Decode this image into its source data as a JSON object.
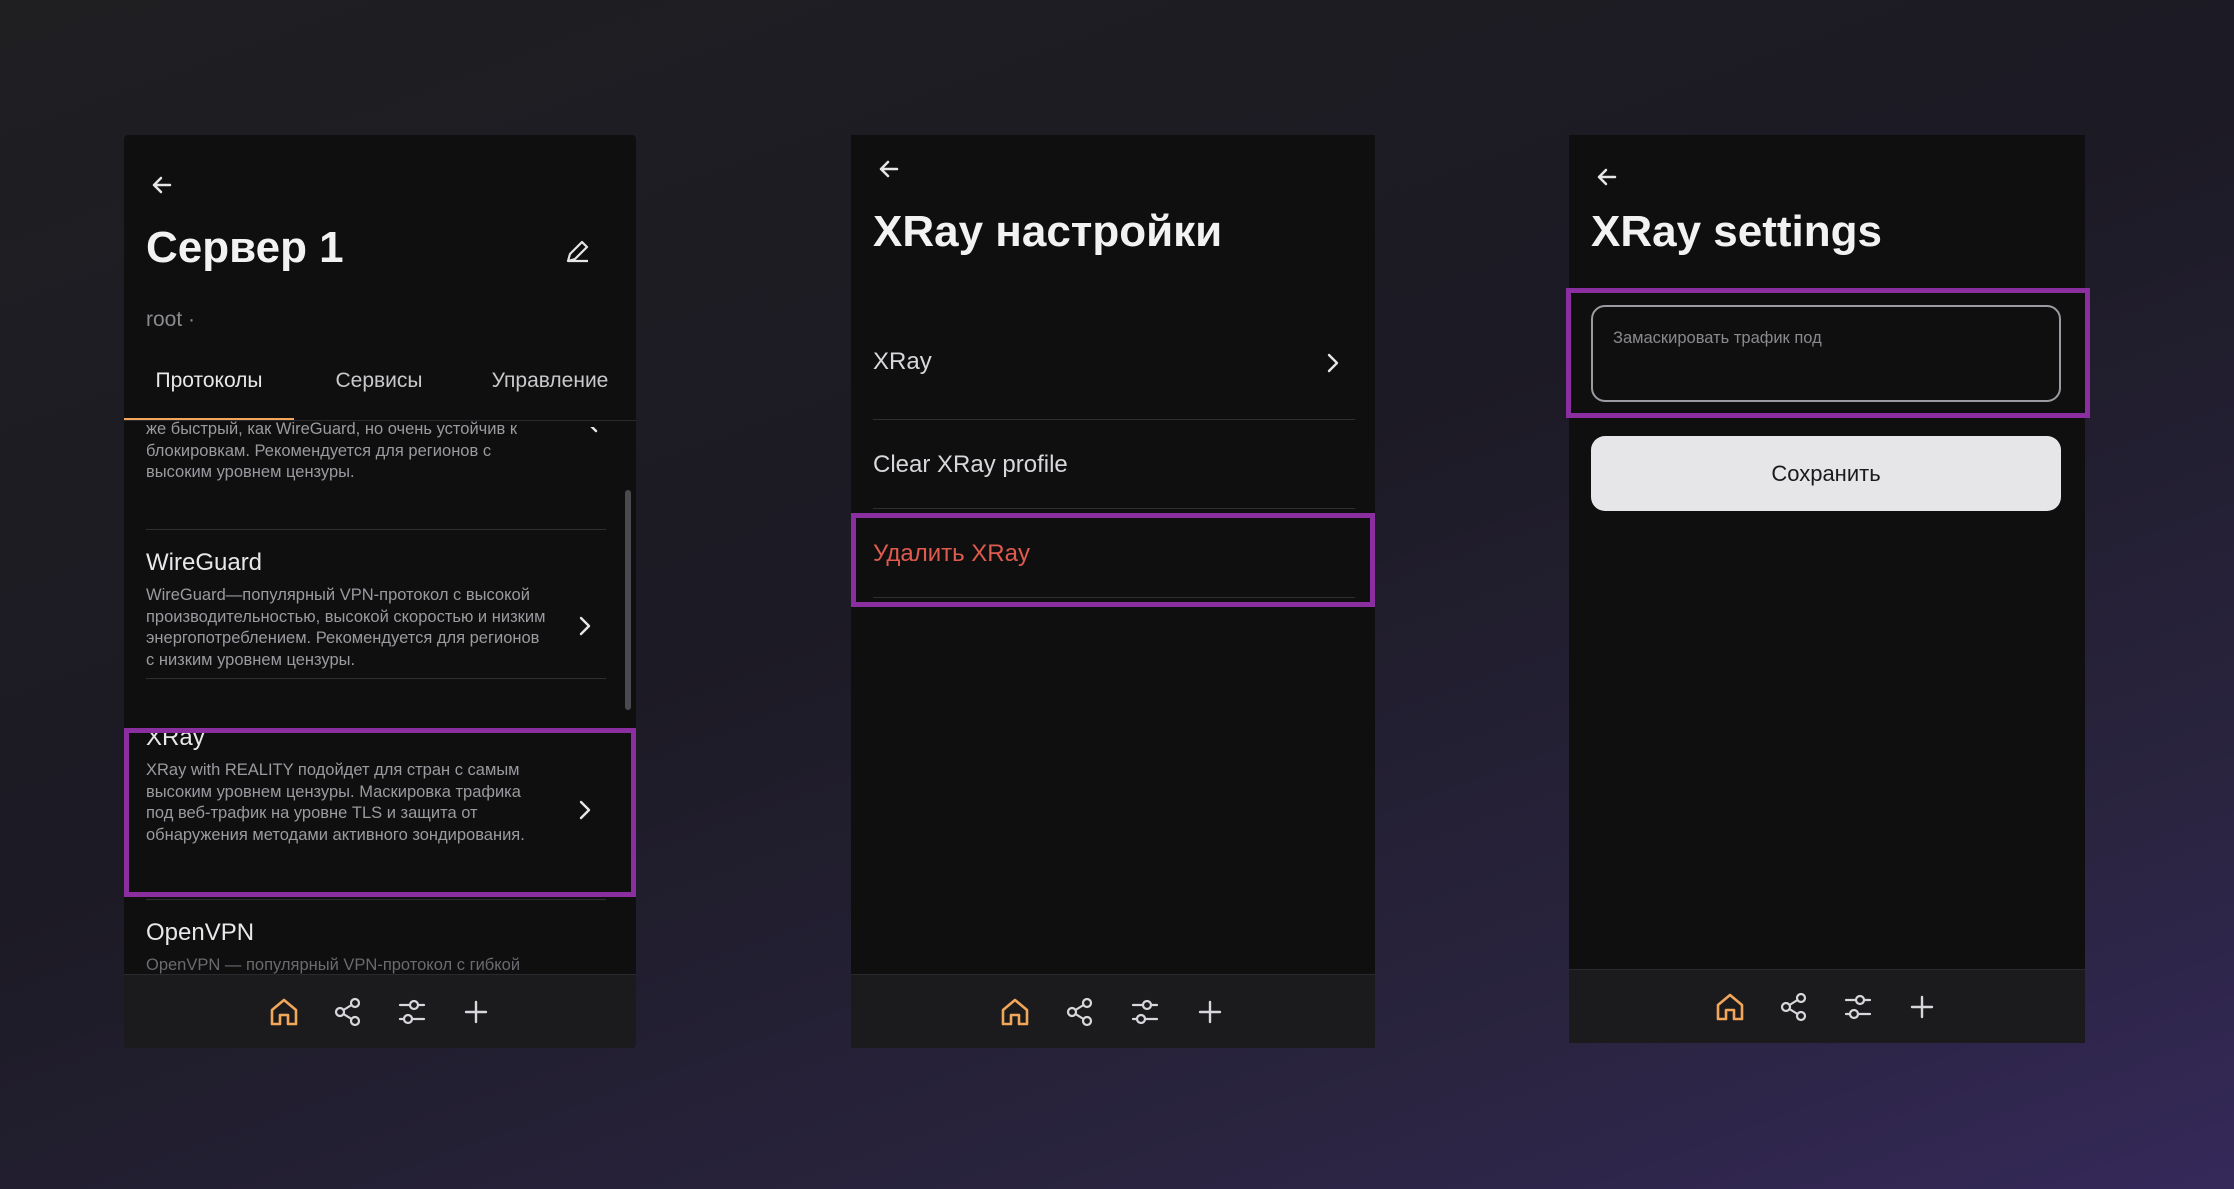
{
  "screen1": {
    "title": "Сервер 1",
    "subtitle": "root ·",
    "tabs": [
      "Протоколы",
      "Сервисы",
      "Управление"
    ],
    "items": [
      {
        "title": "",
        "description": "же быстрый, как WireGuard, но очень устойчив к блокировкам. Рекомендуется для регионов с высоким уровнем цензуры."
      },
      {
        "title": "WireGuard",
        "description": "WireGuard—популярный VPN-протокол с высокой производительностью, высокой скоростью и низким энергопотреблением. Рекомендуется для регионов с низким уровнем цензуры."
      },
      {
        "title": "XRay",
        "description": "XRay with REALITY подойдет для стран с самым высоким уровнем цензуры. Маскировка трафика под веб-трафик на уровне TLS и защита от обнаружения методами активного зондирования."
      },
      {
        "title": "OpenVPN",
        "description": "OpenVPN — популярный VPN-протокол с гибкой"
      }
    ]
  },
  "screen2": {
    "title": "XRay настройки",
    "rows": [
      {
        "label": "XRay"
      },
      {
        "label": "Clear XRay profile"
      },
      {
        "label": "Удалить XRay"
      }
    ]
  },
  "screen3": {
    "title": "XRay settings",
    "field_placeholder": "Замаскировать трафик под",
    "save_label": "Сохранить"
  },
  "colors": {
    "accent": "#f2a65a",
    "highlight": "#8b2fa0",
    "danger": "#e05a4e"
  },
  "nav_icons": [
    "home-icon",
    "share-icon",
    "settings-sliders-icon",
    "plus-icon"
  ]
}
